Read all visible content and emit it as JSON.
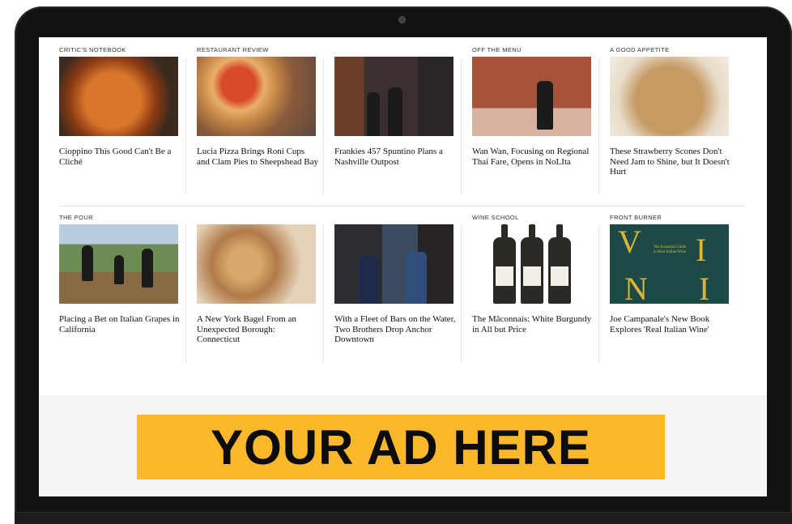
{
  "articles_row1": [
    {
      "kicker": "CRITIC'S NOTEBOOK",
      "headline": "Cioppino This Good Can't Be a Cliché"
    },
    {
      "kicker": "RESTAURANT REVIEW",
      "headline": "Lucia Pizza Brings Roni Cups and Clam Pies to Sheepshead Bay"
    },
    {
      "kicker": "",
      "headline": "Frankies 457 Spuntino Plans a Nashville Outpost"
    },
    {
      "kicker": "OFF THE MENU",
      "headline": "Wan Wan, Focusing on Regional Thai Fare, Opens in NoLIta"
    },
    {
      "kicker": "A GOOD APPETITE",
      "headline": "These Strawberry Scones Don't Need Jam to Shine, but It Doesn't Hurt"
    }
  ],
  "articles_row2": [
    {
      "kicker": "THE POUR",
      "headline": "Placing a Bet on Italian Grapes in California"
    },
    {
      "kicker": "",
      "headline": "A New York Bagel From an Unexpected Borough: Connecticut"
    },
    {
      "kicker": "",
      "headline": "With a Fleet of Bars on the Water, Two Brothers Drop Anchor Downtown"
    },
    {
      "kicker": "WINE SCHOOL",
      "headline": "The Mâconnais: White Burgundy in All but Price"
    },
    {
      "kicker": "FRONT BURNER",
      "headline": "Joe Campanale's New Book Explores 'Real Italian Wine'"
    }
  ],
  "book_cover": {
    "letters": [
      "V",
      "I",
      "N",
      "I"
    ],
    "text": "The Essential Guide to Real Italian Wine"
  },
  "ad": {
    "text": "YOUR AD HERE",
    "color": "#fbb82a"
  }
}
